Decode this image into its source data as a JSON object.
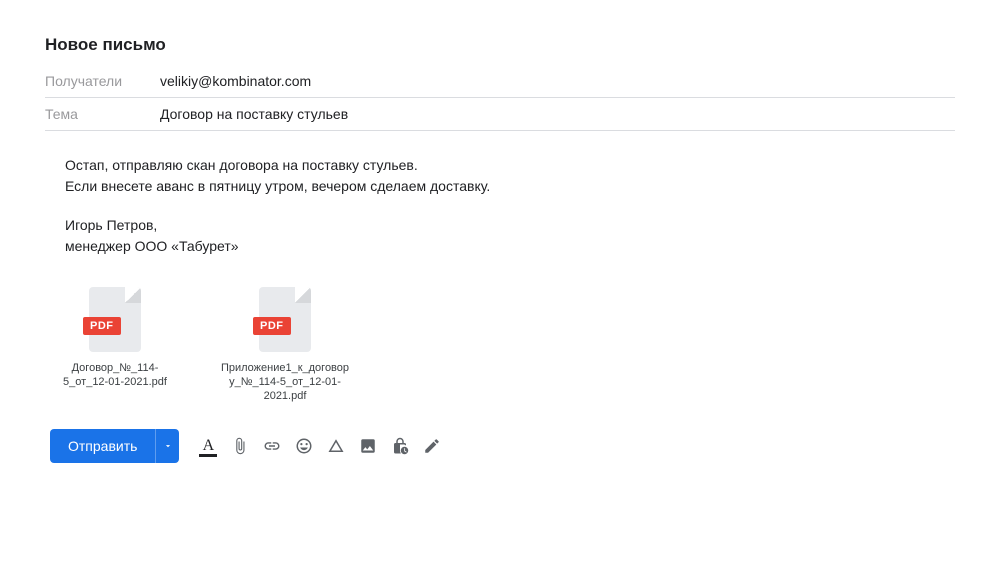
{
  "title": "Новое письмо",
  "fields": {
    "recipients_label": "Получатели",
    "recipients_value": "velikiy@kombinator.com",
    "subject_label": "Тема",
    "subject_value": "Договор на поставку стульев"
  },
  "body": {
    "line1": "Остап, отправляю скан договора на поставку стульев.",
    "line2": "Если внесете аванс в пятницу утром, вечером сделаем доставку.",
    "line3": "Игорь Петров,",
    "line4": "менеджер ООО «Табурет»"
  },
  "attachments": [
    {
      "badge": "PDF",
      "name": "Договор_№_114-5_от_12-01-2021.pdf"
    },
    {
      "badge": "PDF",
      "name": "Приложение1_к_договору_№_114-5_от_12-01-2021.pdf"
    }
  ],
  "toolbar": {
    "send_label": "Отправить"
  }
}
